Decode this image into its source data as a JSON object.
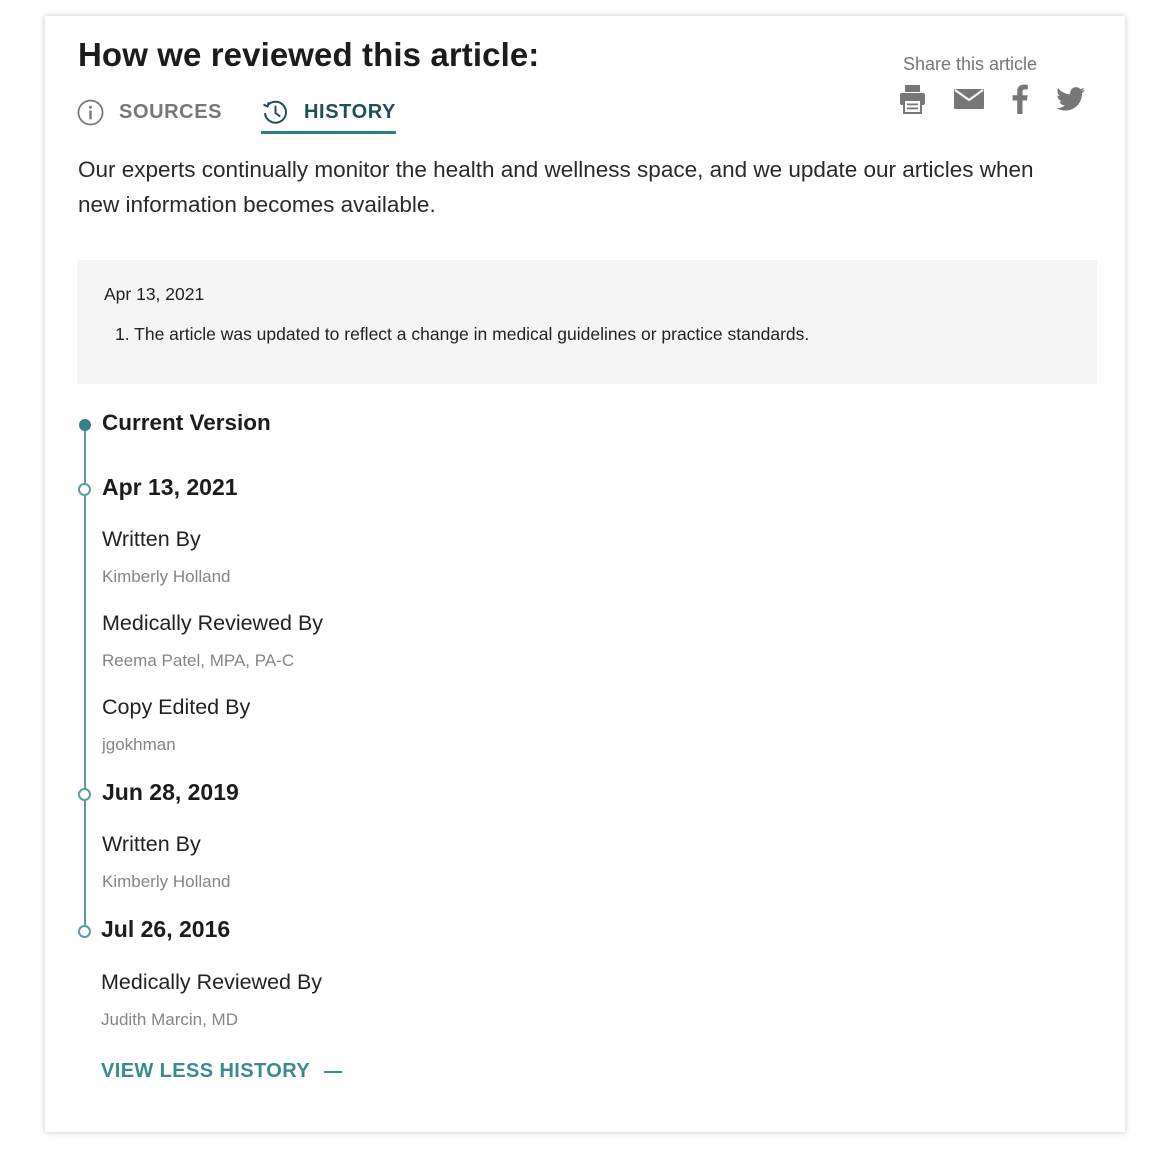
{
  "header": {
    "title": "How we reviewed this article:"
  },
  "tabs": [
    {
      "label": "SOURCES",
      "icon": "info-icon",
      "active": false
    },
    {
      "label": "HISTORY",
      "icon": "history-icon",
      "active": true
    }
  ],
  "share": {
    "label": "Share this article",
    "icons": [
      "print-icon",
      "email-icon",
      "facebook-icon",
      "twitter-icon"
    ]
  },
  "intro": "Our experts continually monitor the health and wellness space, and we update our articles when new information becomes available.",
  "latest_update": {
    "date": "Apr 13, 2021",
    "items": [
      "1. The article was updated to reflect a change in medical guidelines or practice standards."
    ]
  },
  "timeline": {
    "current_label": "Current Version",
    "entries": [
      {
        "date": "Apr 13, 2021",
        "roles": [
          {
            "role": "Written By",
            "person": "Kimberly Holland"
          },
          {
            "role": "Medically Reviewed By",
            "person": "Reema Patel, MPA, PA-C"
          },
          {
            "role": "Copy Edited By",
            "person": "jgokhman"
          }
        ]
      },
      {
        "date": "Jun 28, 2019",
        "roles": [
          {
            "role": "Written By",
            "person": "Kimberly Holland"
          }
        ]
      },
      {
        "date": "Jul 26, 2016",
        "roles": [
          {
            "role": "Medically Reviewed By",
            "person": "Judith Marcin, MD"
          }
        ]
      }
    ]
  },
  "view_less_label": "VIEW LESS HISTORY",
  "colors": {
    "accent": "#3a8a93",
    "accent_dark": "#1f4f5a",
    "muted": "#777777",
    "box_bg": "#f5f5f5"
  }
}
